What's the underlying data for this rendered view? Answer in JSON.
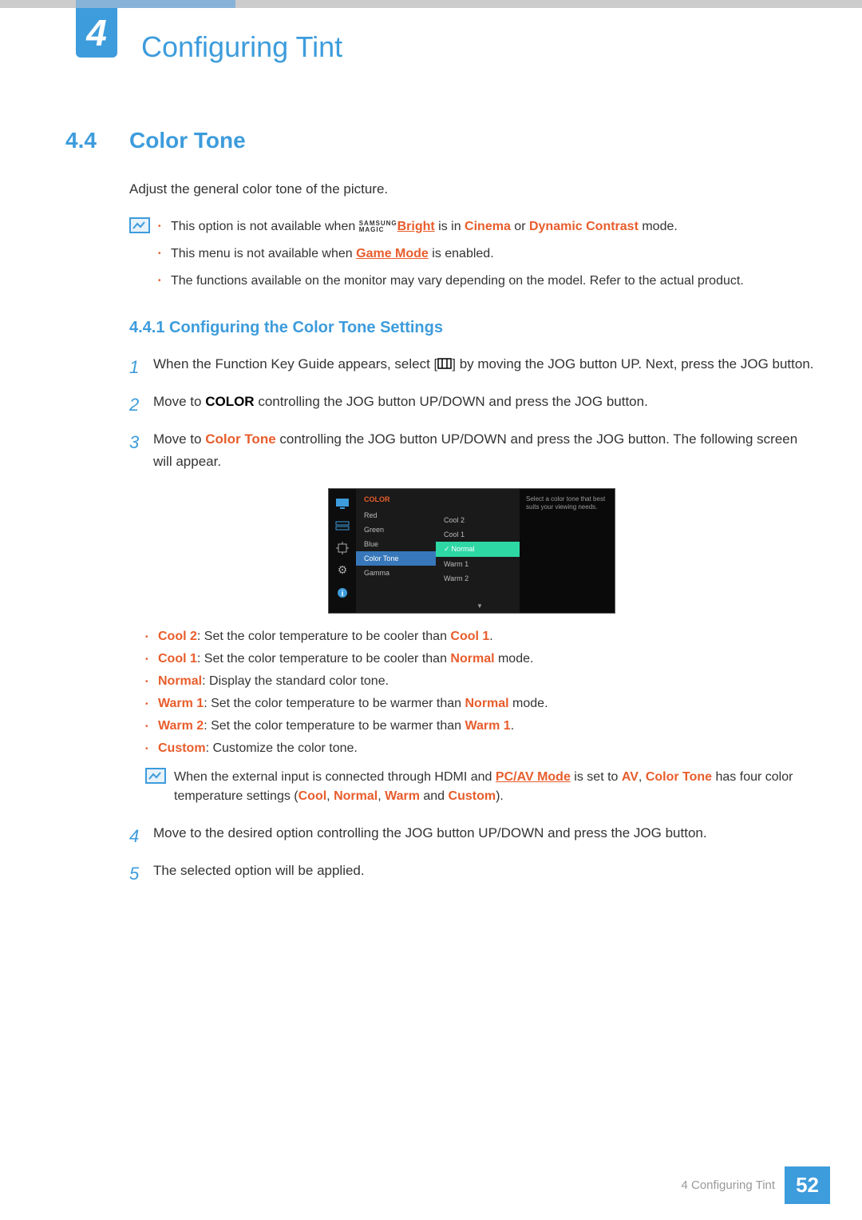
{
  "chapter": {
    "number": "4",
    "title": "Configuring Tint"
  },
  "section": {
    "number": "4.4",
    "title": "Color Tone"
  },
  "intro": "Adjust the general color tone of the picture.",
  "magic": {
    "top": "SAMSUNG",
    "bottom": "MAGIC"
  },
  "notes1": {
    "b1a": "This option is not available when ",
    "b1_bright": "Bright",
    "b1b": " is in ",
    "b1_cinema": "Cinema",
    "b1c": " or ",
    "b1_dynamic": "Dynamic Contrast",
    "b1d": " mode.",
    "b2a": "This menu is not available when ",
    "b2_game": "Game Mode",
    "b2b": " is enabled.",
    "b3": "The functions available on the monitor may vary depending on the model. Refer to the actual product."
  },
  "subsection": "4.4.1  Configuring the Color Tone Settings",
  "steps": {
    "s1a": "When the Function Key Guide appears, select [",
    "s1b": "] by moving the JOG button UP. Next, press the JOG button.",
    "s2a": "Move to ",
    "s2_color": "COLOR",
    "s2b": " controlling the JOG button UP/DOWN and press the JOG button.",
    "s3a": "Move to ",
    "s3_ct": "Color Tone",
    "s3b": " controlling the JOG button UP/DOWN and press the JOG button. The following screen will appear.",
    "s4": "Move to the desired option controlling the JOG button UP/DOWN and press the JOG button.",
    "s5": "The selected option will be applied."
  },
  "osd": {
    "header": "COLOR",
    "menu": [
      "Red",
      "Green",
      "Blue",
      "Color Tone",
      "Gamma"
    ],
    "options": [
      "Cool 2",
      "Cool 1",
      "Normal",
      "Warm 1",
      "Warm 2"
    ],
    "desc": "Select a color tone that best suits your viewing needs."
  },
  "opts": {
    "cool2": "Cool 2",
    "cool2d": ": Set the color temperature to be cooler than ",
    "cool2t": "Cool 1",
    "cool2e": ".",
    "cool1": "Cool 1",
    "cool1d": ": Set the color temperature to be cooler than ",
    "cool1t": "Normal",
    "cool1e": " mode.",
    "normal": "Normal",
    "normald": ": Display the standard color tone.",
    "warm1": "Warm 1",
    "warm1d": ": Set the color temperature to be warmer than ",
    "warm1t": "Normal",
    "warm1e": " mode.",
    "warm2": "Warm 2",
    "warm2d": ": Set the color temperature to be warmer than ",
    "warm2t": "Warm 1",
    "warm2e": ".",
    "custom": "Custom",
    "customd": ": Customize the color tone."
  },
  "note2": {
    "a": "When the external input is connected through HDMI and ",
    "pcav": "PC/AV Mode",
    "b": " is set to ",
    "av": "AV",
    "c": ", ",
    "ct": "Color Tone",
    "d": " has four color temperature settings (",
    "cool": "Cool",
    "comma1": ", ",
    "normal": "Normal",
    "comma2": ", ",
    "warm": "Warm",
    "and": " and ",
    "custom": "Custom",
    "e": ")."
  },
  "footer": {
    "text": "4 Configuring Tint",
    "page": "52"
  }
}
